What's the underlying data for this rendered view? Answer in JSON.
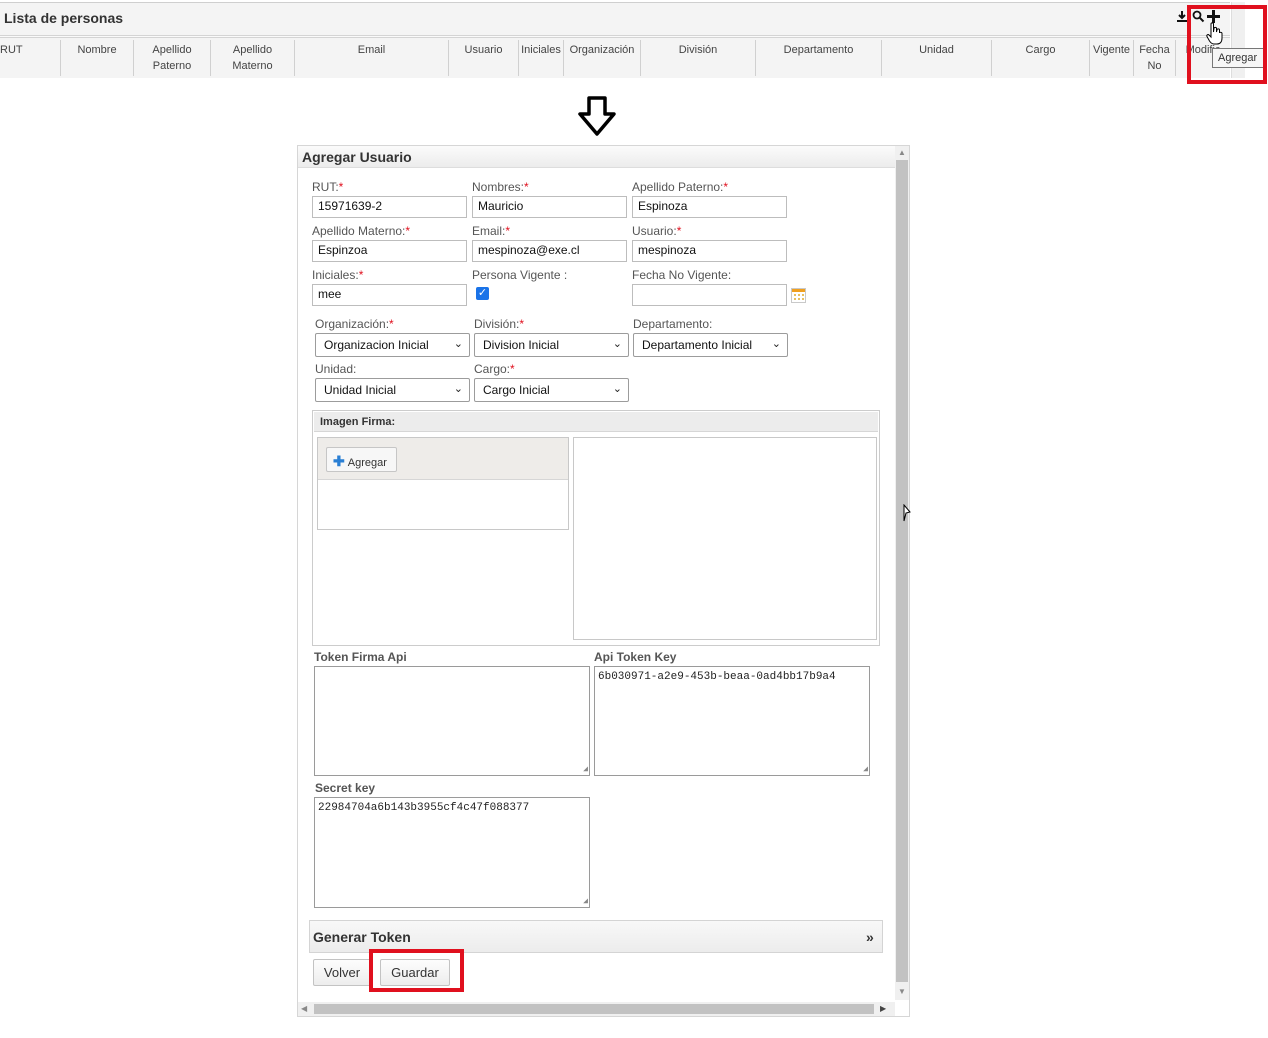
{
  "list": {
    "title": "Lista de personas",
    "columns": [
      {
        "l1": "RUT",
        "l2": ""
      },
      {
        "l1": "Nombre",
        "l2": ""
      },
      {
        "l1": "Apellido",
        "l2": "Paterno"
      },
      {
        "l1": "Apellido",
        "l2": "Materno"
      },
      {
        "l1": "Email",
        "l2": ""
      },
      {
        "l1": "Usuario",
        "l2": ""
      },
      {
        "l1": "Iniciales",
        "l2": ""
      },
      {
        "l1": "Organización",
        "l2": ""
      },
      {
        "l1": "División",
        "l2": ""
      },
      {
        "l1": "Departamento",
        "l2": ""
      },
      {
        "l1": "Unidad",
        "l2": ""
      },
      {
        "l1": "Cargo",
        "l2": ""
      },
      {
        "l1": "Vigente",
        "l2": ""
      },
      {
        "l1": "Fecha",
        "l2": "No"
      },
      {
        "l1": "Modific",
        "l2": ""
      }
    ],
    "tooltip": "Agregar",
    "icons": {
      "download": "download-icon",
      "search": "search-icon",
      "add": "plus-icon"
    }
  },
  "dialog": {
    "title": "Agregar Usuario",
    "fields": {
      "rut": {
        "label": "RUT:",
        "req": "*",
        "value": "15971639-2"
      },
      "nombres": {
        "label": "Nombres:",
        "req": "*",
        "value": "Mauricio"
      },
      "apellido_paterno": {
        "label": "Apellido Paterno:",
        "req": "*",
        "value": "Espinoza"
      },
      "apellido_materno": {
        "label": "Apellido Materno:",
        "req": "*",
        "value": "Espinzoa"
      },
      "email": {
        "label": "Email:",
        "req": "*",
        "value": "mespinoza@exe.cl"
      },
      "usuario": {
        "label": "Usuario:",
        "req": "*",
        "value": "mespinoza"
      },
      "iniciales": {
        "label": "Iniciales:",
        "req": "*",
        "value": "mee"
      },
      "persona_vigente": {
        "label": "Persona Vigente :",
        "checked": true
      },
      "fecha_no_vigente": {
        "label": "Fecha No Vigente:",
        "value": ""
      }
    },
    "selects": {
      "organizacion": {
        "label": "Organización:",
        "req": "*",
        "value": "Organizacion Inicial"
      },
      "division": {
        "label": "División:",
        "req": "*",
        "value": "Division Inicial"
      },
      "departamento": {
        "label": "Departamento:",
        "value": "Departamento Inicial"
      },
      "unidad": {
        "label": "Unidad:",
        "value": "Unidad Inicial"
      },
      "cargo": {
        "label": "Cargo:",
        "req": "*",
        "value": "Cargo Inicial"
      }
    },
    "firma": {
      "label": "Imagen Firma:",
      "add_button": "Agregar"
    },
    "token_firma_api": {
      "label": "Token Firma Api",
      "value": ""
    },
    "api_token_key": {
      "label": "Api Token Key",
      "value": "6b030971-a2e9-453b-beaa-0ad4bb17b9a4"
    },
    "secret_key": {
      "label": "Secret key",
      "value": "22984704a6b143b3955cf4c47f088377"
    },
    "generar_token": {
      "label": "Generar Token",
      "expand": "»"
    },
    "buttons": {
      "volver": "Volver",
      "guardar": "Guardar"
    }
  },
  "colors": {
    "highlight": "#e0101e",
    "checkbox": "#1a73e8"
  }
}
